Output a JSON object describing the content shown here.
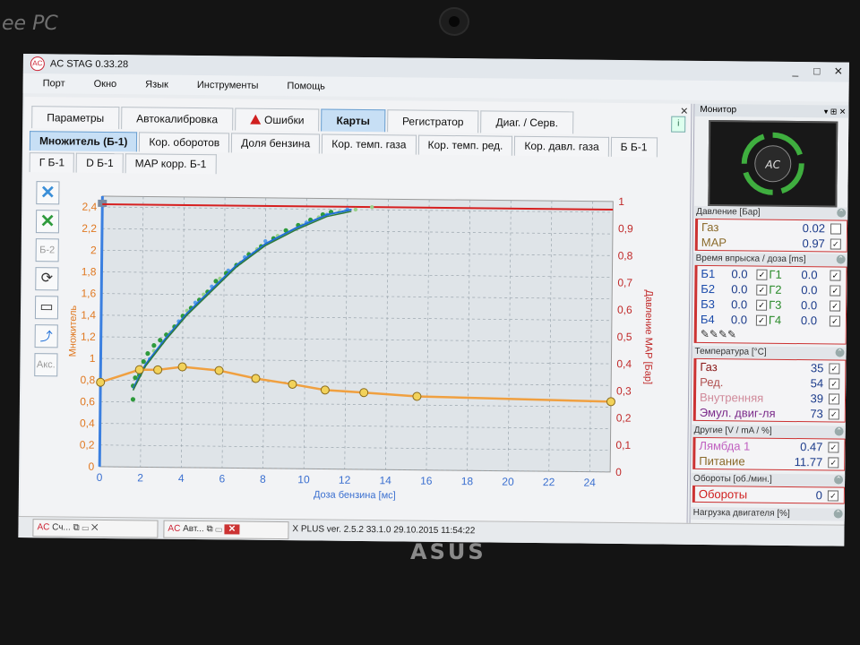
{
  "bezel": {
    "brand_top": "ee PC",
    "brand_bottom": "ASUS"
  },
  "window": {
    "title": "AC STAG 0.33.28",
    "minimize": "_",
    "maximize": "□",
    "close": "✕"
  },
  "menu": [
    "Порт",
    "Окно",
    "Язык",
    "Инструменты",
    "Помощь"
  ],
  "main_tabs": [
    "Параметры",
    "Автокалибровка",
    "Ошибки",
    "Карты",
    "Регистратор",
    "Диаг. / Серв."
  ],
  "map_tabs": [
    "Множитель (Б-1)",
    "Кор. оборотов",
    "Доля бензина",
    "Кор. темп. газа",
    "Кор. темп. ред.",
    "Кор. давл. газа",
    "Б Б-1"
  ],
  "map_tabs2": [
    "Г Б-1",
    "D Б-1",
    "MAP корр. Б-1"
  ],
  "tools": {
    "b2": "Б-2",
    "aks": "Акс."
  },
  "chart_data": {
    "type": "scatter",
    "xlabel": "Доза бензина [мс]",
    "ylabel_left": "Множитель",
    "ylabel_right": "Давление МАР [Бар]",
    "xlim": [
      0,
      25
    ],
    "ylim_left": [
      0,
      2.5
    ],
    "ylim_right": [
      0,
      1
    ],
    "x_ticks": [
      0,
      2,
      4,
      6,
      8,
      10,
      12,
      14,
      16,
      18,
      20,
      22,
      24
    ],
    "y_left_ticks": [
      "0",
      "0,2",
      "0,4",
      "0,6",
      "0,8",
      "1",
      "1,2",
      "1,4",
      "1,6",
      "1,8",
      "2",
      "2,2",
      "2,4"
    ],
    "y_right_ticks": [
      "0",
      "0,1",
      "0,2",
      "0,3",
      "0,4",
      "0,5",
      "0,6",
      "0,7",
      "0,8",
      "0,9",
      "1"
    ],
    "multiplier_curve": [
      [
        0,
        0.78
      ],
      [
        1.9,
        0.9
      ],
      [
        2.8,
        0.9
      ],
      [
        4,
        0.93
      ],
      [
        5.8,
        0.9
      ],
      [
        7.6,
        0.83
      ],
      [
        9.4,
        0.78
      ],
      [
        11,
        0.73
      ],
      [
        12.9,
        0.71
      ],
      [
        15.5,
        0.68
      ],
      [
        25,
        0.65
      ]
    ],
    "map_line": [
      [
        1.6,
        0.29
      ],
      [
        2.2,
        0.38
      ],
      [
        3.2,
        0.48
      ],
      [
        4.2,
        0.57
      ],
      [
        5.4,
        0.66
      ],
      [
        6.6,
        0.75
      ],
      [
        8,
        0.83
      ],
      [
        9.5,
        0.89
      ],
      [
        11,
        0.94
      ],
      [
        12.2,
        0.96
      ]
    ],
    "map_points_green": [
      [
        1.6,
        0.25
      ],
      [
        1.6,
        0.3
      ],
      [
        1.7,
        0.33
      ],
      [
        1.9,
        0.34
      ],
      [
        2.1,
        0.39
      ],
      [
        2.3,
        0.42
      ],
      [
        2.6,
        0.45
      ],
      [
        2.9,
        0.47
      ],
      [
        3.2,
        0.49
      ],
      [
        3.6,
        0.52
      ],
      [
        4,
        0.56
      ],
      [
        4.4,
        0.59
      ],
      [
        4.8,
        0.62
      ],
      [
        5.2,
        0.65
      ],
      [
        5.6,
        0.69
      ],
      [
        6.1,
        0.72
      ],
      [
        6.6,
        0.75
      ],
      [
        7.2,
        0.79
      ],
      [
        7.8,
        0.82
      ],
      [
        8.4,
        0.85
      ],
      [
        9,
        0.88
      ],
      [
        9.6,
        0.9
      ],
      [
        10.2,
        0.92
      ],
      [
        10.8,
        0.94
      ],
      [
        11.2,
        0.95
      ]
    ],
    "map_points_blue": [
      [
        2,
        0.36
      ],
      [
        2.4,
        0.4
      ],
      [
        3,
        0.46
      ],
      [
        3.8,
        0.54
      ],
      [
        4.6,
        0.61
      ],
      [
        5.4,
        0.67
      ],
      [
        6.2,
        0.73
      ],
      [
        7,
        0.78
      ],
      [
        8,
        0.84
      ],
      [
        9,
        0.88
      ],
      [
        10,
        0.91
      ],
      [
        11,
        0.94
      ],
      [
        12,
        0.96
      ]
    ],
    "map_points_light": [
      [
        1.8,
        0.33
      ],
      [
        2.6,
        0.43
      ],
      [
        3.4,
        0.5
      ],
      [
        4.2,
        0.58
      ],
      [
        5,
        0.64
      ],
      [
        5.8,
        0.7
      ],
      [
        6.8,
        0.76
      ],
      [
        7.6,
        0.81
      ],
      [
        8.6,
        0.86
      ],
      [
        9.8,
        0.9
      ],
      [
        10.6,
        0.93
      ],
      [
        11.6,
        0.95
      ],
      [
        12.4,
        0.96
      ],
      [
        13.2,
        0.97
      ]
    ],
    "red_line_y": 0.97,
    "colors": {
      "multiplier": "#f0a040",
      "map_fit": "#1f6fd8",
      "map_green": "#2e9a3c",
      "red": "#d62020",
      "axis_left": "#e07820",
      "axis_right": "#c02828"
    }
  },
  "taskbar": {
    "btn1": "Сч...",
    "btn2": "Авт...",
    "status": "X PLUS  ver. 2.5.2  33.1.0   29.10.2015 11:54:22"
  },
  "monitor": {
    "title": "Монитор",
    "pressure_title": "Давление [Бар]",
    "pressure": [
      {
        "label": "Газ",
        "value": "0.02"
      },
      {
        "label": "MAP",
        "value": "0.97"
      }
    ],
    "inj_title": "Время впрыска / доза [ms]",
    "injectors": [
      {
        "b": "Б1",
        "bv": "0.0",
        "g": "Г1",
        "gv": "0.0"
      },
      {
        "b": "Б2",
        "bv": "0.0",
        "g": "Г2",
        "gv": "0.0"
      },
      {
        "b": "Б3",
        "bv": "0.0",
        "g": "Г3",
        "gv": "0.0"
      },
      {
        "b": "Б4",
        "bv": "0.0",
        "g": "Г4",
        "gv": "0.0"
      }
    ],
    "temp_title": "Температура [°C]",
    "temps": [
      {
        "label": "Газ",
        "value": "35",
        "color": "#8a1a1a"
      },
      {
        "label": "Ред.",
        "value": "54",
        "color": "#b05050"
      },
      {
        "label": "Внутренняя",
        "value": "39",
        "color": "#d08a9a"
      },
      {
        "label": "Эмул. двиг-ля",
        "value": "73",
        "color": "#7a2a8a"
      }
    ],
    "other_title": "Другие [V / mA / %]",
    "others": [
      {
        "label": "Лямбда 1",
        "value": "0.47",
        "color": "#c060c0"
      },
      {
        "label": "Питание",
        "value": "11.77",
        "color": "#8a6a2a"
      }
    ],
    "rpm_title": "Обороты [об./мин.]",
    "rpm": {
      "label": "Обороты",
      "value": "0"
    },
    "load_title": "Нагрузка двигателя [%]"
  }
}
